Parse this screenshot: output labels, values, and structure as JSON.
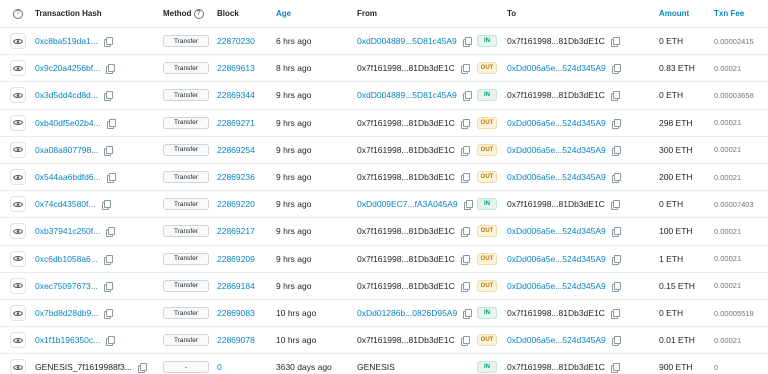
{
  "header": {
    "hash": "Transaction Hash",
    "method": "Method",
    "block": "Block",
    "age": "Age",
    "from": "From",
    "to": "To",
    "amount": "Amount",
    "fee": "Txn Fee"
  },
  "rows": [
    {
      "hash": "0xc8ba519da1...",
      "method": "Transfer",
      "block": "22870230",
      "age": "6 hrs ago",
      "from": "0xdD004889...5D81c45A9",
      "from_link": true,
      "dir": "IN",
      "to": "0x7f161998...81Db3dE1C",
      "to_link": false,
      "amount": "0 ETH",
      "fee": "0.00002415"
    },
    {
      "hash": "0x9c20a4256bf...",
      "method": "Transfer",
      "block": "22869613",
      "age": "8 hrs ago",
      "from": "0x7f161998...81Db3dE1C",
      "from_link": false,
      "dir": "OUT",
      "to": "0xDd006a5e...524d345A9",
      "to_link": true,
      "amount": "0.83 ETH",
      "fee": "0.00021"
    },
    {
      "hash": "0x3d5dd4cd8d...",
      "method": "Transfer",
      "block": "22869344",
      "age": "9 hrs ago",
      "from": "0xdD004889...5D81c45A9",
      "from_link": true,
      "dir": "IN",
      "to": "0x7f161998...81Db3dE1C",
      "to_link": false,
      "amount": "0 ETH",
      "fee": "0.00003658"
    },
    {
      "hash": "0xb40df5e02b4...",
      "method": "Transfer",
      "block": "22869271",
      "age": "9 hrs ago",
      "from": "0x7f161998...81Db3dE1C",
      "from_link": false,
      "dir": "OUT",
      "to": "0xDd006a5e...524d345A9",
      "to_link": true,
      "amount": "298 ETH",
      "fee": "0.00021"
    },
    {
      "hash": "0xa08a807798...",
      "method": "Transfer",
      "block": "22869254",
      "age": "9 hrs ago",
      "from": "0x7f161998...81Db3dE1C",
      "from_link": false,
      "dir": "OUT",
      "to": "0xDd006a5e...524d345A9",
      "to_link": true,
      "amount": "300 ETH",
      "fee": "0.00021"
    },
    {
      "hash": "0x544aa6bdfd6...",
      "method": "Transfer",
      "block": "22869236",
      "age": "9 hrs ago",
      "from": "0x7f161998...81Db3dE1C",
      "from_link": false,
      "dir": "OUT",
      "to": "0xDd006a5e...524d345A9",
      "to_link": true,
      "amount": "200 ETH",
      "fee": "0.00021"
    },
    {
      "hash": "0x74cd43580f...",
      "method": "Transfer",
      "block": "22869220",
      "age": "9 hrs ago",
      "from": "0xDd009EC7...fA3A045A9",
      "from_link": true,
      "dir": "IN",
      "to": "0x7f161998...81Db3dE1C",
      "to_link": false,
      "amount": "0 ETH",
      "fee": "0.00007403"
    },
    {
      "hash": "0xb37941c250f...",
      "method": "Transfer",
      "block": "22869217",
      "age": "9 hrs ago",
      "from": "0x7f161998...81Db3dE1C",
      "from_link": false,
      "dir": "OUT",
      "to": "0xDd006a5e...524d345A9",
      "to_link": true,
      "amount": "100 ETH",
      "fee": "0.00021"
    },
    {
      "hash": "0xc6db1058a6...",
      "method": "Transfer",
      "block": "22869209",
      "age": "9 hrs ago",
      "from": "0x7f161998...81Db3dE1C",
      "from_link": false,
      "dir": "OUT",
      "to": "0xDd006a5e...524d345A9",
      "to_link": true,
      "amount": "1 ETH",
      "fee": "0.00021"
    },
    {
      "hash": "0xec75097673...",
      "method": "Transfer",
      "block": "22869184",
      "age": "9 hrs ago",
      "from": "0x7f161998...81Db3dE1C",
      "from_link": false,
      "dir": "OUT",
      "to": "0xDd006a5e...524d345A9",
      "to_link": true,
      "amount": "0.15 ETH",
      "fee": "0.00021"
    },
    {
      "hash": "0x7bd8d28db9...",
      "method": "Transfer",
      "block": "22869083",
      "age": "10 hrs ago",
      "from": "0xDd01286b...0826D95A9",
      "from_link": true,
      "dir": "IN",
      "to": "0x7f161998...81Db3dE1C",
      "to_link": false,
      "amount": "0 ETH",
      "fee": "0.00005519"
    },
    {
      "hash": "0x1f1b196350c...",
      "method": "Transfer",
      "block": "22869078",
      "age": "10 hrs ago",
      "from": "0x7f161998...81Db3dE1C",
      "from_link": false,
      "dir": "OUT",
      "to": "0xDd006a5e...524d345A9",
      "to_link": true,
      "amount": "0.01 ETH",
      "fee": "0.00021"
    },
    {
      "hash": "GENESIS_7f1619988f3...",
      "hash_plain": true,
      "method": "-",
      "block": "0",
      "age": "3630 days ago",
      "from": "GENESIS",
      "from_link": false,
      "from_nocopy": true,
      "dir": "IN",
      "to": "0x7f161998...81Db3dE1C",
      "to_link": false,
      "amount": "900 ETH",
      "fee": "0"
    }
  ],
  "colors": {
    "link": "#0784c3",
    "in": "#00a186",
    "out": "#b47d00"
  }
}
